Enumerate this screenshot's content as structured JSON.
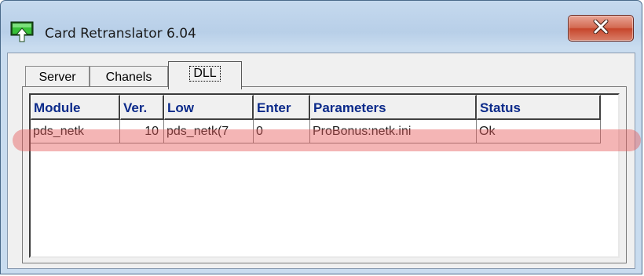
{
  "window": {
    "title": "Card Retranslator 6.04"
  },
  "tabs": [
    {
      "label": "Server"
    },
    {
      "label": "Chanels"
    },
    {
      "label": "DLL"
    }
  ],
  "table": {
    "columns": [
      "Module",
      "Ver.",
      "Low",
      "Enter",
      "Parameters",
      "Status"
    ],
    "rows": [
      [
        "pds_netk",
        "10",
        "pds_netk(7",
        "0",
        "ProBonus:netk.ini",
        "Ok"
      ]
    ]
  },
  "colors": {
    "header_text": "#0b2a8a",
    "highlight": "#e65a5a",
    "close_button": "#c7452b"
  },
  "icons": {
    "app": "network-card-icon",
    "close": "close-icon"
  }
}
